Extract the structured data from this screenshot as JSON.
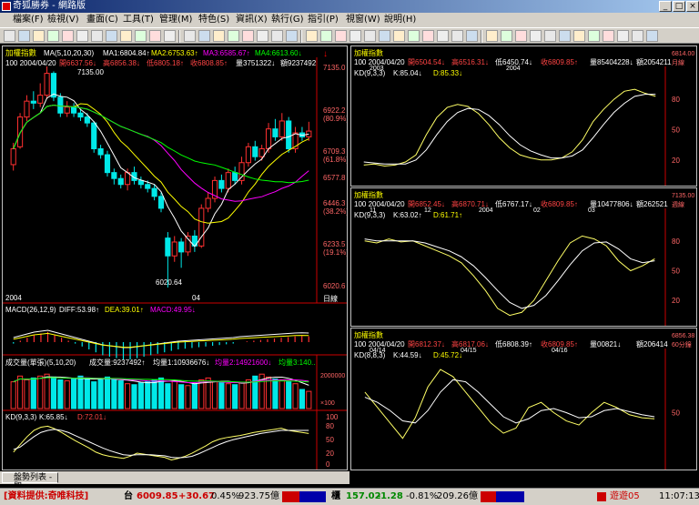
{
  "window": {
    "title": "奇狐勝券 - 網路版"
  },
  "menu": [
    "檔案(F)",
    "檢視(V)",
    "畫面(C)",
    "工具(T)",
    "管理(M)",
    "特色(S)",
    "資訊(X)",
    "執行(G)",
    "指引(P)",
    "視窗(W)",
    "說明(H)"
  ],
  "main_chart": {
    "title": "加權指數",
    "ma_text": "MA(5,10,20,30)",
    "ma1": "MA1:6804.84↑",
    "ma2": "MA2:6753.63↑",
    "ma3": "MA3:6585.67↑",
    "ma4": "MA4:6613.60↓",
    "info": "100 2004/04/20",
    "open": "開6637.56↓",
    "high": "高6856.38↓",
    "low": "低6805.18↑",
    "close": "收6808.85↑",
    "vol": "量3751322↓",
    "amount": "額9237492",
    "top_label": "7135.00",
    "low_label": "6020.64",
    "y_ticks": [
      "7135.0",
      "6922.2",
      "(80.9%)",
      "6709.3",
      "(61.8%)",
      "6577.8",
      "6446.3",
      "(38.2%)",
      "6233.5",
      "(19.1%)",
      "6020.6"
    ],
    "x_labels": [
      "2004",
      "04"
    ],
    "period": "日線",
    "chart_data": {
      "type": "candlestick",
      "ylim": [
        6020.6,
        7135.0
      ],
      "candles": [
        {
          "o": 6640,
          "c": 6720,
          "h": 6750,
          "l": 6610
        },
        {
          "o": 6730,
          "c": 6880,
          "h": 6900,
          "l": 6720
        },
        {
          "o": 6880,
          "c": 6960,
          "h": 6990,
          "l": 6860
        },
        {
          "o": 6960,
          "c": 6950,
          "h": 7010,
          "l": 6920
        },
        {
          "o": 6950,
          "c": 6990,
          "h": 7050,
          "l": 6930
        },
        {
          "o": 6990,
          "c": 7100,
          "h": 7135,
          "l": 6970
        },
        {
          "o": 7100,
          "c": 6980,
          "h": 7110,
          "l": 6960
        },
        {
          "o": 6980,
          "c": 6900,
          "h": 7000,
          "l": 6880
        },
        {
          "o": 6900,
          "c": 6930,
          "h": 6960,
          "l": 6880
        },
        {
          "o": 6930,
          "c": 6900,
          "h": 6950,
          "l": 6880
        },
        {
          "o": 6900,
          "c": 6880,
          "h": 6920,
          "l": 6860
        },
        {
          "o": 6880,
          "c": 6850,
          "h": 6900,
          "l": 6830
        },
        {
          "o": 6850,
          "c": 6720,
          "h": 6860,
          "l": 6700
        },
        {
          "o": 6720,
          "c": 6690,
          "h": 6740,
          "l": 6670
        },
        {
          "o": 6690,
          "c": 6600,
          "h": 6710,
          "l": 6580
        },
        {
          "o": 6600,
          "c": 6570,
          "h": 6620,
          "l": 6540
        },
        {
          "o": 6570,
          "c": 6540,
          "h": 6590,
          "l": 6520
        },
        {
          "o": 6540,
          "c": 6600,
          "h": 6620,
          "l": 6510
        },
        {
          "o": 6600,
          "c": 6560,
          "h": 6630,
          "l": 6540
        },
        {
          "o": 6560,
          "c": 6540,
          "h": 6580,
          "l": 6520
        },
        {
          "o": 6540,
          "c": 6520,
          "h": 6560,
          "l": 6500
        },
        {
          "o": 6520,
          "c": 6480,
          "h": 6540,
          "l": 6460
        },
        {
          "o": 6480,
          "c": 6420,
          "h": 6500,
          "l": 6400
        },
        {
          "o": 6270,
          "c": 6180,
          "h": 6300,
          "l": 6020.64
        },
        {
          "o": 6180,
          "c": 6250,
          "h": 6280,
          "l": 6150
        },
        {
          "o": 6250,
          "c": 6200,
          "h": 6270,
          "l": 6120
        },
        {
          "o": 6200,
          "c": 6280,
          "h": 6300,
          "l": 6180
        },
        {
          "o": 6280,
          "c": 6230,
          "h": 6310,
          "l": 6200
        },
        {
          "o": 6230,
          "c": 6420,
          "h": 6440,
          "l": 6220
        },
        {
          "o": 6420,
          "c": 6470,
          "h": 6500,
          "l": 6400
        },
        {
          "o": 6470,
          "c": 6560,
          "h": 6580,
          "l": 6450
        },
        {
          "o": 6560,
          "c": 6520,
          "h": 6590,
          "l": 6500
        },
        {
          "o": 6520,
          "c": 6600,
          "h": 6620,
          "l": 6500
        },
        {
          "o": 6600,
          "c": 6560,
          "h": 6630,
          "l": 6540
        },
        {
          "o": 6560,
          "c": 6650,
          "h": 6680,
          "l": 6540
        },
        {
          "o": 6650,
          "c": 6730,
          "h": 6750,
          "l": 6630
        },
        {
          "o": 6730,
          "c": 6680,
          "h": 6760,
          "l": 6660
        },
        {
          "o": 6680,
          "c": 6720,
          "h": 6740,
          "l": 6660
        },
        {
          "o": 6720,
          "c": 6820,
          "h": 6850,
          "l": 6700
        },
        {
          "o": 6820,
          "c": 6780,
          "h": 6870,
          "l": 6760
        },
        {
          "o": 6780,
          "c": 6860,
          "h": 6900,
          "l": 6760
        },
        {
          "o": 6860,
          "c": 6720,
          "h": 6880,
          "l": 6700
        },
        {
          "o": 6720,
          "c": 6800,
          "h": 6830,
          "l": 6700
        },
        {
          "o": 6800,
          "c": 6780,
          "h": 6830,
          "l": 6760
        },
        {
          "o": 6780,
          "c": 6809,
          "h": 6856,
          "l": 6760
        }
      ]
    }
  },
  "macd": {
    "label": "MACD(26,12,9)",
    "diff": "DIFF:53.98↑",
    "dea": "DEA:39.01↑",
    "macd": "MACD:49.95↓",
    "chart_data": {
      "type": "bar",
      "values": [
        -0.1,
        0.1,
        0.3,
        0.5,
        0.6,
        0.7,
        0.5,
        0.3,
        0.1,
        -0.1,
        -0.3,
        -0.5,
        -0.7,
        -0.9,
        -1,
        -1.1,
        -1.2,
        -1.2,
        -1.1,
        -1,
        -0.9,
        -0.8,
        -0.7,
        -0.6,
        -0.5,
        -0.45,
        -0.4,
        -0.35,
        -0.3,
        -0.25,
        -0.2,
        -0.15,
        -0.1,
        0,
        0.05,
        0.1,
        0.15,
        0.2,
        0.25,
        0.3,
        0.35,
        0.4,
        0.42,
        0.4
      ]
    }
  },
  "volume": {
    "label": "成交量(單張)(5,10,20)",
    "vol": "成交量:9237492↑",
    "ma1": "均量1:10936676↓",
    "ma2": "均量2:14921600↓",
    "ma3": "均量3:140..",
    "y_ticks": [
      "2000000",
      "×100"
    ],
    "chart_data": {
      "type": "bar",
      "ylim": [
        0,
        2000000
      ],
      "values": [
        1400000,
        1700000,
        1500000,
        1600000,
        1700000,
        1800000,
        1650000,
        1500000,
        1450000,
        1550000,
        1700000,
        1600000,
        1400000,
        1500000,
        1650000,
        1550000,
        1450000,
        1300000,
        1250000,
        1350000,
        1400000,
        1500000,
        1600000,
        1300000,
        1450000,
        1250000,
        1200000,
        1300000,
        1500000,
        1600000,
        1400000,
        1350000,
        1300000,
        1250000,
        1350000,
        1500000,
        1700000,
        1800000,
        1650000,
        1550000,
        1500000,
        1400000,
        1300000,
        1000000,
        900000
      ],
      "up": [
        true,
        true,
        true,
        false,
        true,
        true,
        false,
        false,
        true,
        false,
        false,
        false,
        false,
        false,
        false,
        false,
        false,
        true,
        false,
        false,
        false,
        false,
        false,
        false,
        true,
        false,
        true,
        false,
        true,
        true,
        true,
        false,
        true,
        false,
        true,
        true,
        false,
        true,
        true,
        false,
        true,
        false,
        true,
        false,
        true
      ]
    }
  },
  "kd_main": {
    "label": "KD(9,3,3)",
    "k": "K:65.85↓",
    "d": "D:72.01↓",
    "y_ticks": [
      "100",
      "80",
      "50",
      "20",
      "0"
    ],
    "chart_data": {
      "type": "line",
      "ylim": [
        0,
        100
      ],
      "series": [
        {
          "name": "K",
          "values": [
            30,
            45,
            60,
            72,
            78,
            80,
            75,
            68,
            60,
            52,
            45,
            38,
            30,
            25,
            22,
            20,
            18,
            22,
            28,
            26,
            24,
            22,
            20,
            15,
            18,
            22,
            28,
            35,
            42,
            50,
            55,
            58,
            60,
            62,
            65,
            68,
            70,
            72,
            74,
            76,
            72,
            70,
            68,
            66
          ]
        },
        {
          "name": "D",
          "values": [
            35,
            40,
            50,
            60,
            68,
            72,
            74,
            72,
            68,
            62,
            56,
            50,
            44,
            38,
            33,
            29,
            25,
            24,
            25,
            25,
            25,
            24,
            23,
            20,
            19,
            20,
            22,
            27,
            33,
            39,
            45,
            50,
            54,
            57,
            60,
            63,
            66,
            68,
            70,
            72,
            72,
            72,
            72,
            72
          ]
        }
      ]
    }
  },
  "right_panels": [
    {
      "title": "加權指數",
      "info": "100 2004/04/20",
      "open": "開6504.54↓",
      "high": "高6516.31↓",
      "low": "低6450.74↓",
      "close": "收6809.85↑",
      "vol": "量85404228↓",
      "amount": "額2054211",
      "period": "月線",
      "top_label": "6814.00",
      "kd_label": "KD(9,3,3)",
      "k": "K:85.04↓",
      "d": "D:85.33↓",
      "x_labels": [
        "2003",
        "2004"
      ],
      "y_ticks": [
        "80",
        "50",
        "20"
      ],
      "chart_data": {
        "type": "line",
        "ylim": [
          0,
          100
        ],
        "series": [
          {
            "name": "K",
            "values": [
              15,
              16,
              14,
              15,
              18,
              25,
              45,
              62,
              72,
              75,
              73,
              66,
              55,
              42,
              32,
              25,
              22,
              20,
              20,
              22,
              28,
              40,
              58,
              70,
              80,
              88,
              90,
              86,
              83
            ]
          },
          {
            "name": "D",
            "values": [
              18,
              17,
              16,
              16,
              16,
              20,
              30,
              45,
              58,
              67,
              71,
              70,
              64,
              55,
              44,
              35,
              29,
              25,
              22,
              22,
              24,
              30,
              42,
              55,
              67,
              76,
              83,
              85,
              85
            ]
          }
        ]
      }
    },
    {
      "title": "加權指數",
      "info": "100 2004/04/20",
      "open": "開6852.45↓",
      "high": "高6870.71↓",
      "low": "低6767.17↓",
      "close": "收6809.85↑",
      "vol": "量10477806↓",
      "amount": "額262521",
      "period": "週線",
      "top_label": "7135.00",
      "kd_label": "KD(9,3,3)",
      "k": "K:63.02↑",
      "d": "D:61.71↑",
      "x_labels": [
        "11",
        "12",
        "2004",
        "02",
        "03"
      ],
      "y_ticks": [
        "80",
        "50",
        "20"
      ],
      "chart_data": {
        "type": "line",
        "ylim": [
          0,
          100
        ],
        "series": [
          {
            "name": "K",
            "values": [
              80,
              78,
              82,
              79,
              80,
              75,
              70,
              65,
              58,
              45,
              30,
              12,
              5,
              8,
              20,
              40,
              60,
              78,
              85,
              82,
              75,
              60,
              50,
              55,
              62
            ]
          },
          {
            "name": "D",
            "values": [
              82,
              80,
              80,
              80,
              80,
              78,
              74,
              70,
              64,
              55,
              43,
              30,
              18,
              12,
              15,
              25,
              40,
              56,
              70,
              78,
              79,
              72,
              62,
              58,
              60
            ]
          }
        ]
      }
    },
    {
      "title": "加權指數",
      "info": "100 2004/04/20",
      "open": "開6812.37↓",
      "high": "高6817.06↓",
      "low": "低6808.39↑",
      "close": "收6809.85↑",
      "vol": "量00821↓",
      "amount": "額206414",
      "period": "60分鐘",
      "top_label": "6856.38",
      "kd_label": "KD(8,8,3)",
      "k": "K:44.59↓",
      "d": "D:45.72↓",
      "x_labels": [
        "04/14",
        "04/15",
        "04/16"
      ],
      "y_ticks": [
        "50"
      ],
      "chart_data": {
        "type": "line",
        "ylim": [
          0,
          100
        ],
        "series": [
          {
            "name": "K",
            "values": [
              70,
              55,
              40,
              25,
              45,
              75,
              92,
              85,
              70,
              55,
              40,
              30,
              35,
              55,
              60,
              50,
              42,
              38,
              50,
              60,
              55,
              48,
              45,
              44
            ]
          },
          {
            "name": "D",
            "values": [
              65,
              60,
              52,
              42,
              40,
              52,
              70,
              82,
              80,
              70,
              58,
              46,
              40,
              44,
              52,
              54,
              50,
              45,
              46,
              52,
              54,
              51,
              48,
              46
            ]
          }
        ]
      }
    }
  ],
  "tab": {
    "label": "盤勢列表 - 即..."
  },
  "status": {
    "source": "[資料提供:奇唯科技]",
    "mkt1": "台",
    "idx1": "6009.85",
    "chg1": "+30.67",
    "pct1": "0.45%",
    "amt1": "923.75億",
    "mkt2": "櫃",
    "idx2": "157.02",
    "chg2": "-1.28",
    "pct2": "-0.81%",
    "amt2": "209.26億",
    "user": "遊遊05",
    "time": "11:07:13"
  }
}
